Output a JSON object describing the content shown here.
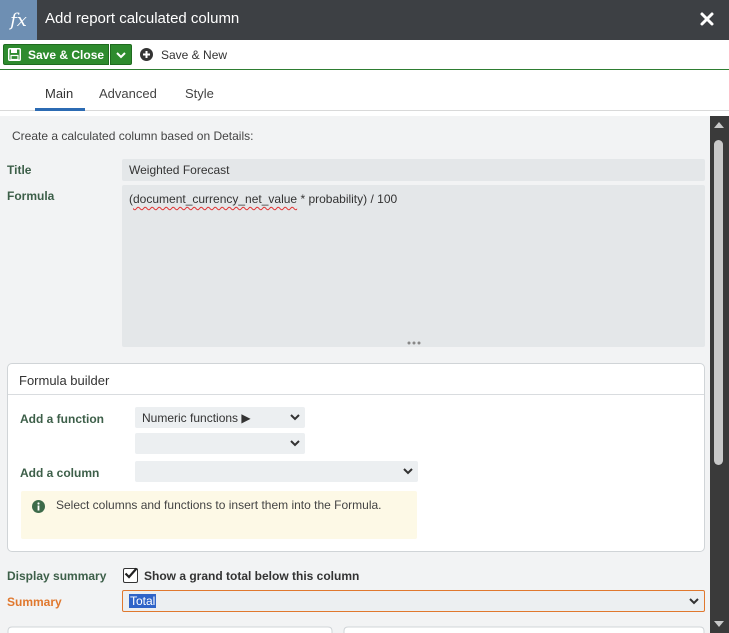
{
  "dialog": {
    "title": "Add report calculated column",
    "fx_icon": "fx"
  },
  "toolbar": {
    "save_close_label": "Save & Close",
    "save_new_label": "Save & New"
  },
  "tabs": [
    {
      "label": "Main",
      "active": true
    },
    {
      "label": "Advanced",
      "active": false
    },
    {
      "label": "Style",
      "active": false
    }
  ],
  "main": {
    "intro": "Create a calculated column based on Details:",
    "title_label": "Title",
    "title_value": "Weighted Forecast",
    "formula_label": "Formula",
    "formula_prefix": "(",
    "formula_misspelled": "document_currency_net_value",
    "formula_suffix": " * probability) / 100"
  },
  "builder": {
    "heading": "Formula builder",
    "add_function_label": "Add a function",
    "function_category_value": "Numeric functions ▶",
    "function_value": "",
    "add_column_label": "Add a column",
    "column_value": "",
    "note": "Select columns and functions to insert them into the Formula."
  },
  "summary": {
    "display_label": "Display summary",
    "checkbox_label": "Show a grand total below this column",
    "checkbox_checked": true,
    "summary_label": "Summary",
    "summary_value": "Total"
  },
  "colors": {
    "titlebar": "#3d4044",
    "fx_badge": "#6e8fb3",
    "save_green": "#2e8b2e",
    "label_green": "#3d5f49",
    "summary_orange": "#e0782e",
    "tab_underline": "#2c6bb3",
    "note_bg": "#fdf9e6"
  }
}
